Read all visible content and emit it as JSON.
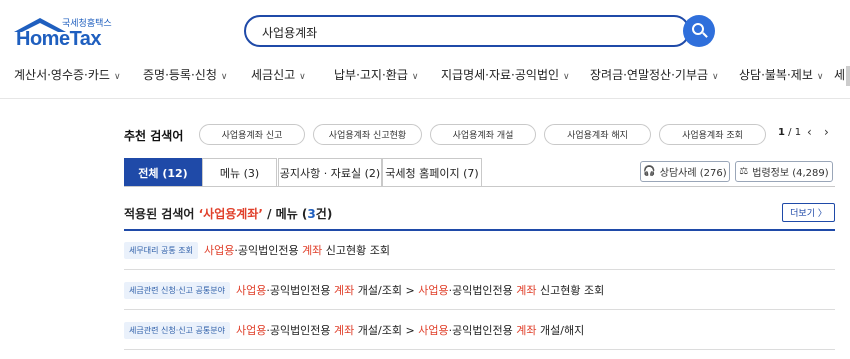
{
  "header": {
    "logo_sub": "국세청홈택스",
    "logo_main": "HomeTax",
    "search_value": "사업용계좌"
  },
  "nav": {
    "items": [
      "계산서·영수증·카드",
      "증명·등록·신청",
      "세금신고",
      "납부·고지·환급",
      "지급명세·자료·공익법인",
      "장려금·연말정산·기부금",
      "상담·불복·제보",
      "세"
    ]
  },
  "recommend": {
    "label": "추천 검색어",
    "chips": [
      "사업용계좌 신고",
      "사업용계좌 신고현황",
      "사업용계좌 개설",
      "사업용계좌 해지",
      "사업용계좌 조회"
    ],
    "page_current": "1",
    "page_sep": " / ",
    "page_total": "1"
  },
  "tabs": [
    {
      "label": "전체 (12)"
    },
    {
      "label": "메뉴 (3)"
    },
    {
      "label": "공지사항 · 자료실 (2)"
    },
    {
      "label": "국세청 홈페이지 (7)"
    }
  ],
  "pills": [
    {
      "label": "상담사례 (276)",
      "icon": "headset-icon"
    },
    {
      "label": "법령정보 (4,289)",
      "icon": "gavel-icon"
    }
  ],
  "results": {
    "title_pre": "적용된 검색어 ",
    "title_term": "‘사업용계좌’",
    "title_mid": " / 메뉴 (",
    "title_count": "3",
    "title_post": "건)",
    "more_label": "더보기 〉",
    "rows": [
      {
        "tag": "세무대리 공통 조회",
        "parts": [
          "사업용",
          "·공익법인전용 ",
          "계좌",
          " 신고현황 조회"
        ]
      },
      {
        "tag": "세금관련 신청·신고 공통분야",
        "parts": [
          "사업용",
          "·공익법인전용 ",
          "계좌",
          " 개설/조회 > ",
          "사업용",
          "·공익법인전용 ",
          "계좌",
          " 신고현황 조회"
        ]
      },
      {
        "tag": "세금관련 신청·신고 공통분야",
        "parts": [
          "사업용",
          "·공익법인전용 ",
          "계좌",
          " 개설/조회 > ",
          "사업용",
          "·공익법인전용 ",
          "계좌",
          " 개설/해지"
        ]
      }
    ]
  },
  "colors": {
    "brand": "#1f4aa8",
    "highlight": "#e0402b"
  }
}
